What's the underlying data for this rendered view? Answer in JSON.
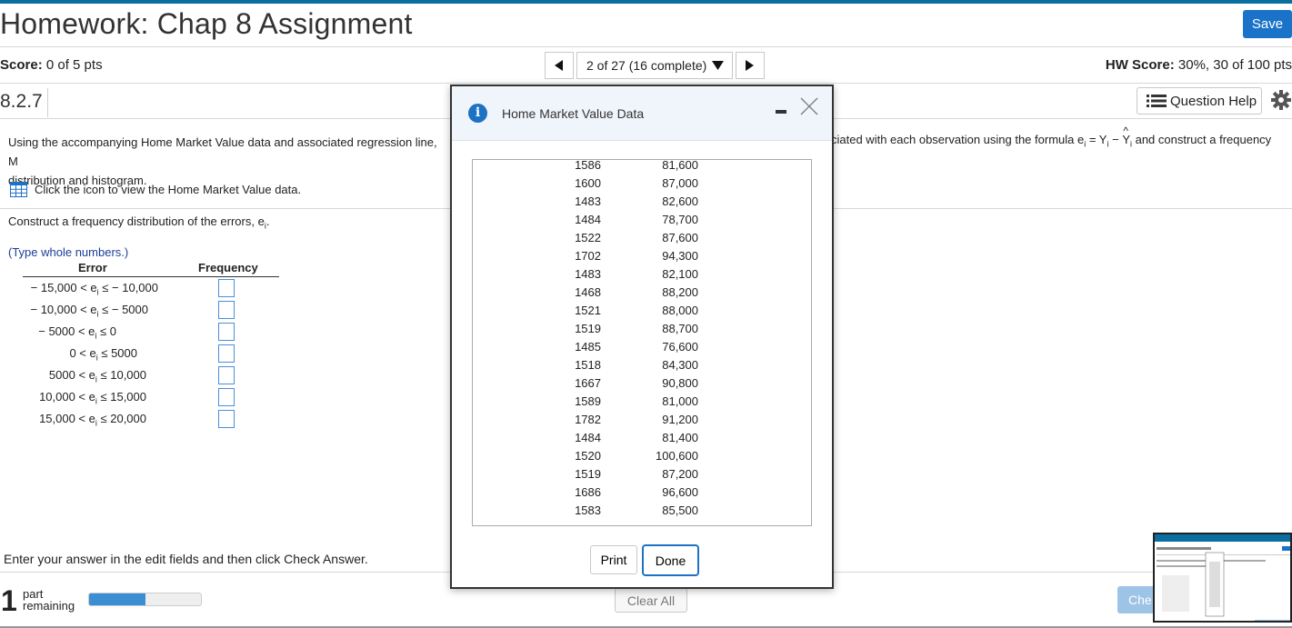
{
  "header": {
    "title": "Homework: Chap 8 Assignment",
    "save_label": "Save",
    "score_label": "Score:",
    "score_value": "0 of 5 pts",
    "hw_score_label": "HW Score:",
    "hw_score_value": "30%, 30 of 100 pts",
    "nav_position": "2 of 27 (16 complete)"
  },
  "question": {
    "number": "8.2.7",
    "help_label": "Question Help",
    "instruction_left": "Using the accompanying Home Market Value data and associated regression line, M",
    "instruction_left_line2": "distribution and histogram.",
    "instruction_right": "ciated with each observation using the formula e",
    "instruction_right_tail": " and construct a frequency",
    "formula_i": "i",
    "formula_eq": " = Y",
    "formula_minus": " − ",
    "formula_yhat": "Y",
    "formula_hat": "^",
    "click_icon_text": "Click the icon to view the Home Market Value data.",
    "construct_text": "Construct a frequency distribution of the errors, e",
    "construct_tail": ".",
    "type_hint": "(Type whole numbers.)",
    "col_error": "Error",
    "col_frequency": "Frequency",
    "rows": [
      {
        "label": "− 15,000 < e",
        "rel": " ≤ − 10,000"
      },
      {
        "label": "− 10,000 < e",
        "rel": " ≤ − 5000"
      },
      {
        "label": "− 5000 < e",
        "rel": " ≤ 0"
      },
      {
        "label": "0 < e",
        "rel": " ≤ 5000"
      },
      {
        "label": "5000 < e",
        "rel": " ≤ 10,000"
      },
      {
        "label": "10,000 < e",
        "rel": " ≤ 15,000"
      },
      {
        "label": "15,000 < e",
        "rel": " ≤ 20,000"
      }
    ]
  },
  "footer": {
    "enter_answer": "Enter your answer in the edit fields and then click Check Answer.",
    "parts_count": "1",
    "parts_word1": "part",
    "parts_word2": "remaining",
    "progress_fraction": 0.5,
    "clear_all": "Clear All",
    "check_answer": "Che"
  },
  "modal": {
    "title": "Home Market Value Data",
    "print_label": "Print",
    "done_label": "Done",
    "data": [
      [
        "1586",
        "81,600"
      ],
      [
        "1600",
        "87,000"
      ],
      [
        "1483",
        "82,600"
      ],
      [
        "1484",
        "78,700"
      ],
      [
        "1522",
        "87,600"
      ],
      [
        "1702",
        "94,300"
      ],
      [
        "1483",
        "82,100"
      ],
      [
        "1468",
        "88,200"
      ],
      [
        "1521",
        "88,000"
      ],
      [
        "1519",
        "88,700"
      ],
      [
        "1485",
        "76,600"
      ],
      [
        "1518",
        "84,300"
      ],
      [
        "1667",
        "90,800"
      ],
      [
        "1589",
        "81,000"
      ],
      [
        "1782",
        "91,200"
      ],
      [
        "1484",
        "81,400"
      ],
      [
        "1520",
        "100,600"
      ],
      [
        "1519",
        "87,200"
      ],
      [
        "1686",
        "96,600"
      ],
      [
        "1583",
        "85,500"
      ]
    ]
  },
  "colors": {
    "accent": "#1a73c8",
    "topbar": "#0a6ea1",
    "progress": "#3b8ed4",
    "hint": "#1a3e9a"
  }
}
